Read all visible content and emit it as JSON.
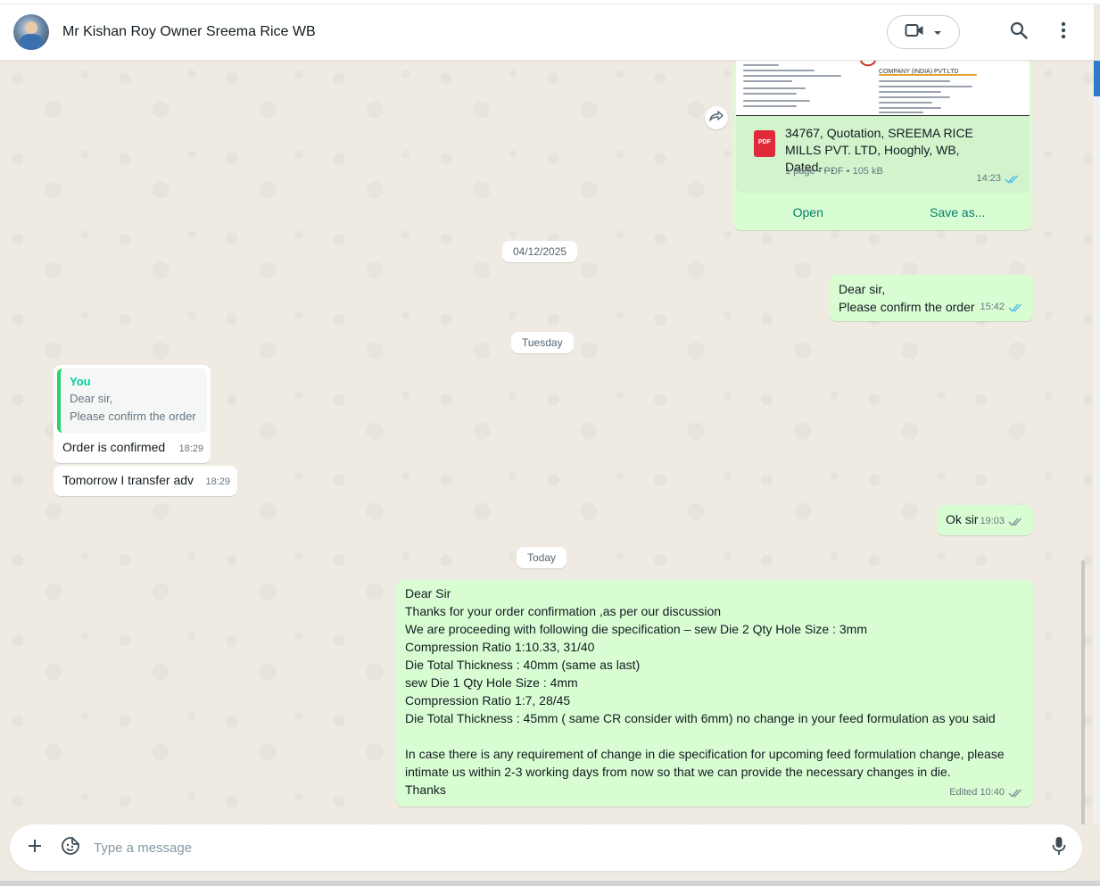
{
  "header": {
    "contact_name": "Mr Kishan Roy Owner Sreema Rice WB"
  },
  "document_message": {
    "company_header": "COMPANY (INDIA) PVT.LTD",
    "title": "34767, Quotation, SREEMA RICE MILLS PVT. LTD, Hooghly, WB, Dated-…",
    "details": "1 page • PDF • 105 kB",
    "pdf_label": "PDF",
    "time": "14:23",
    "open_label": "Open",
    "save_label": "Save as..."
  },
  "dates": {
    "d1": "04/12/2025",
    "d2": "Tuesday",
    "d3": "Today"
  },
  "messages": {
    "m1": {
      "line1": "Dear sir,",
      "line2": "Please confirm the order",
      "time": "15:42"
    },
    "m2": {
      "quote_author": "You",
      "quote_line1": "Dear sir,",
      "quote_line2": "Please confirm the order",
      "text": "Order is confirmed",
      "time": "18:29"
    },
    "m3": {
      "text": "Tomorrow I transfer adv",
      "time": "18:29"
    },
    "m4": {
      "text": "Ok sir",
      "time": "19:03"
    },
    "m5": {
      "lines": [
        "Dear Sir",
        "Thanks for your order confirmation ,as per our discussion",
        "We are proceeding with following die specification –  sew Die 2 Qty Hole Size :  3mm",
        "Compression Ratio 1:10.33, 31/40",
        "Die Total Thickness : 40mm (same as last)",
        "sew Die 1 Qty Hole Size :  4mm",
        "Compression Ratio 1:7, 28/45",
        "Die Total Thickness : 45mm ( same CR consider with 6mm) no change in your feed formulation as you said",
        "",
        "In case there is any requirement of change in die specification for upcoming feed formulation change, please",
        "intimate us within 2-3 working days from now so that we can provide the necessary changes in die.",
        "Thanks"
      ],
      "time": "Edited 10:40"
    }
  },
  "composer": {
    "placeholder": "Type a message"
  },
  "icons": {
    "video": "video-call-icon",
    "dropdown": "chevron-down-icon",
    "search": "search-icon",
    "menu": "menu-icon",
    "attach": "plus-icon",
    "sticker": "sticker-icon",
    "mic": "microphone-icon",
    "forward": "forward-icon",
    "read": "double-check-icon"
  },
  "colors": {
    "outgoing": "#d9fdd3",
    "incoming": "#ffffff",
    "accent": "#008069",
    "read_tick": "#53bdeb",
    "pdf": "#e02a3a"
  }
}
